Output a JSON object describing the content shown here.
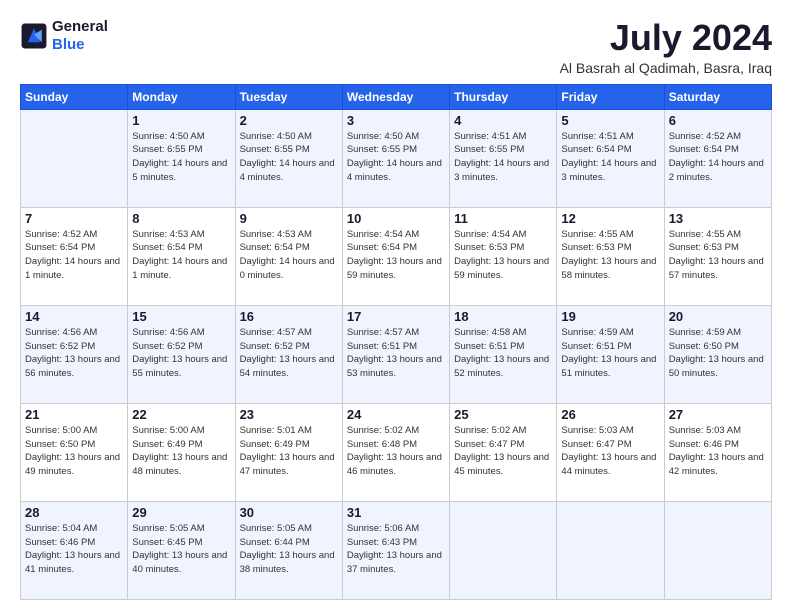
{
  "logo": {
    "line1": "General",
    "line2": "Blue"
  },
  "title": "July 2024",
  "location": "Al Basrah al Qadimah, Basra, Iraq",
  "days_of_week": [
    "Sunday",
    "Monday",
    "Tuesday",
    "Wednesday",
    "Thursday",
    "Friday",
    "Saturday"
  ],
  "weeks": [
    [
      {
        "day": "",
        "sunrise": "",
        "sunset": "",
        "daylight": ""
      },
      {
        "day": "1",
        "sunrise": "Sunrise: 4:50 AM",
        "sunset": "Sunset: 6:55 PM",
        "daylight": "Daylight: 14 hours and 5 minutes."
      },
      {
        "day": "2",
        "sunrise": "Sunrise: 4:50 AM",
        "sunset": "Sunset: 6:55 PM",
        "daylight": "Daylight: 14 hours and 4 minutes."
      },
      {
        "day": "3",
        "sunrise": "Sunrise: 4:50 AM",
        "sunset": "Sunset: 6:55 PM",
        "daylight": "Daylight: 14 hours and 4 minutes."
      },
      {
        "day": "4",
        "sunrise": "Sunrise: 4:51 AM",
        "sunset": "Sunset: 6:55 PM",
        "daylight": "Daylight: 14 hours and 3 minutes."
      },
      {
        "day": "5",
        "sunrise": "Sunrise: 4:51 AM",
        "sunset": "Sunset: 6:54 PM",
        "daylight": "Daylight: 14 hours and 3 minutes."
      },
      {
        "day": "6",
        "sunrise": "Sunrise: 4:52 AM",
        "sunset": "Sunset: 6:54 PM",
        "daylight": "Daylight: 14 hours and 2 minutes."
      }
    ],
    [
      {
        "day": "7",
        "sunrise": "Sunrise: 4:52 AM",
        "sunset": "Sunset: 6:54 PM",
        "daylight": "Daylight: 14 hours and 1 minute."
      },
      {
        "day": "8",
        "sunrise": "Sunrise: 4:53 AM",
        "sunset": "Sunset: 6:54 PM",
        "daylight": "Daylight: 14 hours and 1 minute."
      },
      {
        "day": "9",
        "sunrise": "Sunrise: 4:53 AM",
        "sunset": "Sunset: 6:54 PM",
        "daylight": "Daylight: 14 hours and 0 minutes."
      },
      {
        "day": "10",
        "sunrise": "Sunrise: 4:54 AM",
        "sunset": "Sunset: 6:54 PM",
        "daylight": "Daylight: 13 hours and 59 minutes."
      },
      {
        "day": "11",
        "sunrise": "Sunrise: 4:54 AM",
        "sunset": "Sunset: 6:53 PM",
        "daylight": "Daylight: 13 hours and 59 minutes."
      },
      {
        "day": "12",
        "sunrise": "Sunrise: 4:55 AM",
        "sunset": "Sunset: 6:53 PM",
        "daylight": "Daylight: 13 hours and 58 minutes."
      },
      {
        "day": "13",
        "sunrise": "Sunrise: 4:55 AM",
        "sunset": "Sunset: 6:53 PM",
        "daylight": "Daylight: 13 hours and 57 minutes."
      }
    ],
    [
      {
        "day": "14",
        "sunrise": "Sunrise: 4:56 AM",
        "sunset": "Sunset: 6:52 PM",
        "daylight": "Daylight: 13 hours and 56 minutes."
      },
      {
        "day": "15",
        "sunrise": "Sunrise: 4:56 AM",
        "sunset": "Sunset: 6:52 PM",
        "daylight": "Daylight: 13 hours and 55 minutes."
      },
      {
        "day": "16",
        "sunrise": "Sunrise: 4:57 AM",
        "sunset": "Sunset: 6:52 PM",
        "daylight": "Daylight: 13 hours and 54 minutes."
      },
      {
        "day": "17",
        "sunrise": "Sunrise: 4:57 AM",
        "sunset": "Sunset: 6:51 PM",
        "daylight": "Daylight: 13 hours and 53 minutes."
      },
      {
        "day": "18",
        "sunrise": "Sunrise: 4:58 AM",
        "sunset": "Sunset: 6:51 PM",
        "daylight": "Daylight: 13 hours and 52 minutes."
      },
      {
        "day": "19",
        "sunrise": "Sunrise: 4:59 AM",
        "sunset": "Sunset: 6:51 PM",
        "daylight": "Daylight: 13 hours and 51 minutes."
      },
      {
        "day": "20",
        "sunrise": "Sunrise: 4:59 AM",
        "sunset": "Sunset: 6:50 PM",
        "daylight": "Daylight: 13 hours and 50 minutes."
      }
    ],
    [
      {
        "day": "21",
        "sunrise": "Sunrise: 5:00 AM",
        "sunset": "Sunset: 6:50 PM",
        "daylight": "Daylight: 13 hours and 49 minutes."
      },
      {
        "day": "22",
        "sunrise": "Sunrise: 5:00 AM",
        "sunset": "Sunset: 6:49 PM",
        "daylight": "Daylight: 13 hours and 48 minutes."
      },
      {
        "day": "23",
        "sunrise": "Sunrise: 5:01 AM",
        "sunset": "Sunset: 6:49 PM",
        "daylight": "Daylight: 13 hours and 47 minutes."
      },
      {
        "day": "24",
        "sunrise": "Sunrise: 5:02 AM",
        "sunset": "Sunset: 6:48 PM",
        "daylight": "Daylight: 13 hours and 46 minutes."
      },
      {
        "day": "25",
        "sunrise": "Sunrise: 5:02 AM",
        "sunset": "Sunset: 6:47 PM",
        "daylight": "Daylight: 13 hours and 45 minutes."
      },
      {
        "day": "26",
        "sunrise": "Sunrise: 5:03 AM",
        "sunset": "Sunset: 6:47 PM",
        "daylight": "Daylight: 13 hours and 44 minutes."
      },
      {
        "day": "27",
        "sunrise": "Sunrise: 5:03 AM",
        "sunset": "Sunset: 6:46 PM",
        "daylight": "Daylight: 13 hours and 42 minutes."
      }
    ],
    [
      {
        "day": "28",
        "sunrise": "Sunrise: 5:04 AM",
        "sunset": "Sunset: 6:46 PM",
        "daylight": "Daylight: 13 hours and 41 minutes."
      },
      {
        "day": "29",
        "sunrise": "Sunrise: 5:05 AM",
        "sunset": "Sunset: 6:45 PM",
        "daylight": "Daylight: 13 hours and 40 minutes."
      },
      {
        "day": "30",
        "sunrise": "Sunrise: 5:05 AM",
        "sunset": "Sunset: 6:44 PM",
        "daylight": "Daylight: 13 hours and 38 minutes."
      },
      {
        "day": "31",
        "sunrise": "Sunrise: 5:06 AM",
        "sunset": "Sunset: 6:43 PM",
        "daylight": "Daylight: 13 hours and 37 minutes."
      },
      {
        "day": "",
        "sunrise": "",
        "sunset": "",
        "daylight": ""
      },
      {
        "day": "",
        "sunrise": "",
        "sunset": "",
        "daylight": ""
      },
      {
        "day": "",
        "sunrise": "",
        "sunset": "",
        "daylight": ""
      }
    ]
  ]
}
